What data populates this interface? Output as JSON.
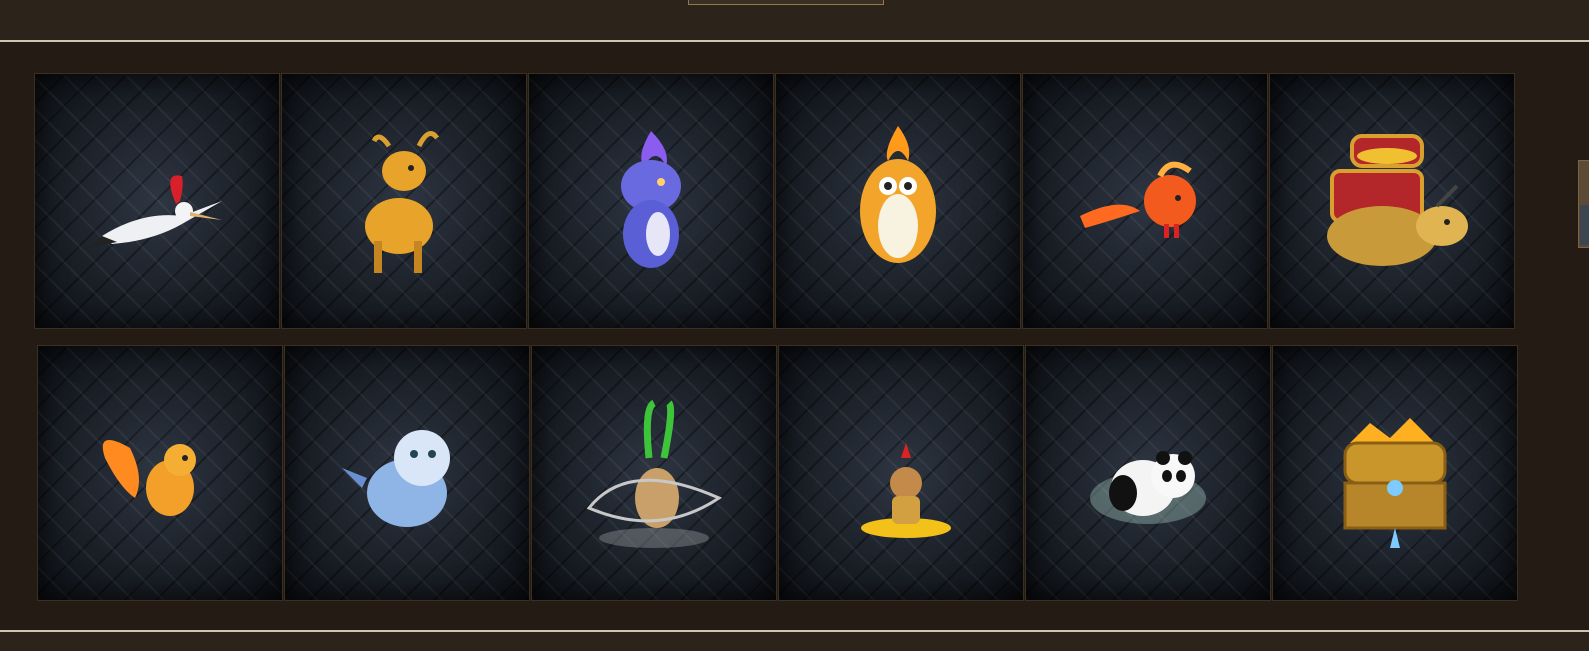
{
  "pets": {
    "row1": [
      {
        "icon": "crane-icon"
      },
      {
        "icon": "golden-deer-icon"
      },
      {
        "icon": "purple-spirit-cat-icon"
      },
      {
        "icon": "fire-owl-icon"
      },
      {
        "icon": "phoenix-chick-icon"
      },
      {
        "icon": "treasure-turtle-dragon-icon"
      }
    ],
    "row2": [
      {
        "icon": "fire-squirrel-icon"
      },
      {
        "icon": "ice-lion-cub-icon"
      },
      {
        "icon": "mantis-warrior-icon"
      },
      {
        "icon": "tribal-warrior-icon"
      },
      {
        "icon": "panda-icon"
      },
      {
        "icon": "golden-treasure-chest-icon"
      }
    ]
  },
  "colors": {
    "background": "#2c241b",
    "panel": "#231b14",
    "divider": "#cfc7b6",
    "tile": "#1c222b"
  }
}
